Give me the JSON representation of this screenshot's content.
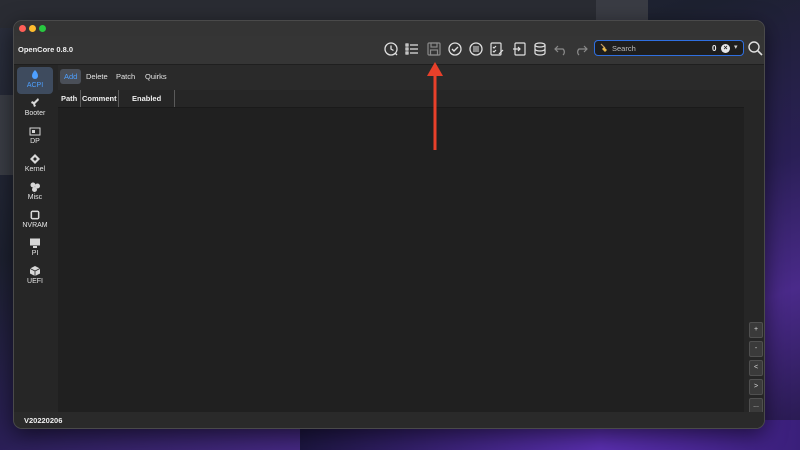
{
  "app": {
    "title": "OpenCore 0.8.0",
    "version": "V20220206"
  },
  "toolbar": {
    "icons": [
      "history-icon",
      "list-icon",
      "save-icon",
      "checkmark-icon",
      "list-circle-icon",
      "checklist-edit-icon",
      "import-icon",
      "database-icon",
      "undo-icon",
      "redo-icon"
    ]
  },
  "search": {
    "placeholder": "Search",
    "count": "0",
    "clear_symbol": "×",
    "caret_symbol": "▾"
  },
  "sidebar": {
    "items": [
      {
        "label": "ACPI",
        "icon": "acpi-icon",
        "active": true
      },
      {
        "label": "Booter",
        "icon": "booter-icon"
      },
      {
        "label": "DP",
        "icon": "device-properties-icon"
      },
      {
        "label": "Kernel",
        "icon": "kernel-icon"
      },
      {
        "label": "Misc",
        "icon": "misc-icon"
      },
      {
        "label": "NVRAM",
        "icon": "nvram-icon"
      },
      {
        "label": "PI",
        "icon": "platforminfo-icon"
      },
      {
        "label": "UEFI",
        "icon": "uefi-icon"
      }
    ]
  },
  "tabs": [
    {
      "label": "Add",
      "active": true
    },
    {
      "label": "Delete"
    },
    {
      "label": "Patch"
    },
    {
      "label": "Quirks"
    }
  ],
  "table": {
    "columns": [
      "Path",
      "Comment",
      "Enabled"
    ],
    "rows": []
  },
  "side_buttons": [
    "+",
    "-",
    "<",
    ">",
    "..."
  ],
  "colors": {
    "accent": "#4ea0ff",
    "annotation_arrow": "#e8402a",
    "search_border": "#2f6fe0"
  }
}
